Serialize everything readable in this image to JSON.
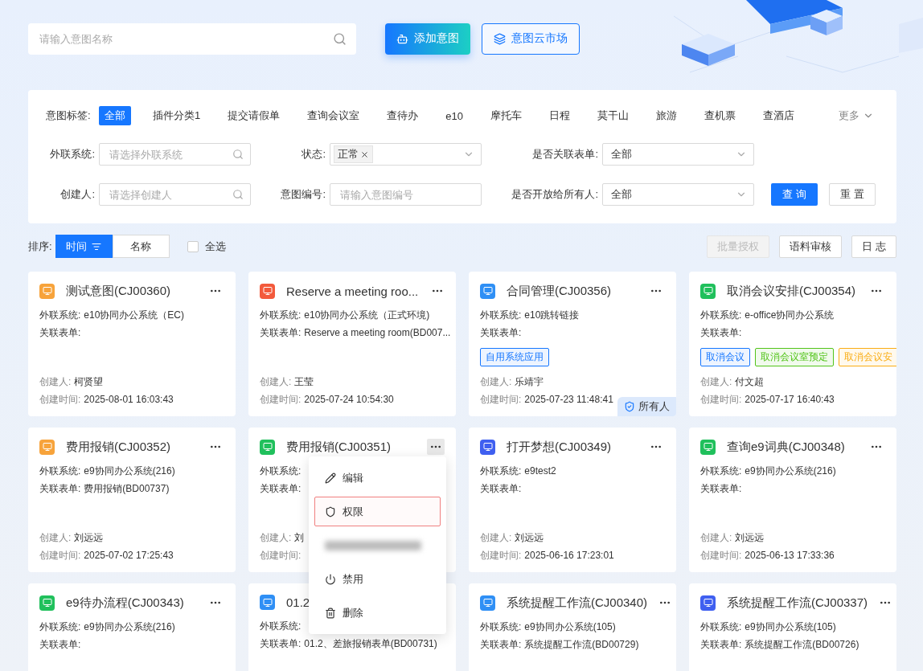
{
  "search": {
    "placeholder": "请输入意图名称"
  },
  "actions": [
    {
      "label": "添加意图",
      "kind": "primary"
    },
    {
      "label": "意图云市场",
      "kind": "outline"
    }
  ],
  "filters": {
    "tag_label": "意图标签:",
    "tags": [
      {
        "label": "全部",
        "selected": true
      },
      {
        "label": "插件分类1",
        "selected": false
      },
      {
        "label": "提交请假单",
        "selected": false
      },
      {
        "label": "查询会议室",
        "selected": false
      },
      {
        "label": "查待办",
        "selected": false
      },
      {
        "label": "e10",
        "selected": false
      },
      {
        "label": "摩托车",
        "selected": false
      },
      {
        "label": "日程",
        "selected": false
      },
      {
        "label": "莫干山",
        "selected": false
      },
      {
        "label": "旅游",
        "selected": false
      },
      {
        "label": "查机票",
        "selected": false
      },
      {
        "label": "查酒店",
        "selected": false
      }
    ],
    "more": "更多",
    "fields": [
      {
        "label": "外联系统:",
        "kind": "search",
        "placeholder": "请选择外联系统"
      },
      {
        "label": "状态:",
        "kind": "chips",
        "chips": [
          "正常"
        ]
      },
      {
        "label": "是否关联表单:",
        "kind": "select",
        "value": "全部"
      },
      {
        "label": "创建人:",
        "kind": "search",
        "placeholder": "请选择创建人"
      },
      {
        "label": "意图编号:",
        "kind": "text",
        "placeholder": "请输入意图编号"
      },
      {
        "label": "是否开放给所有人:",
        "kind": "select",
        "value": "全部"
      }
    ],
    "buttons": [
      {
        "label": "查 询",
        "kind": "primary"
      },
      {
        "label": "重 置",
        "kind": "outline"
      }
    ]
  },
  "toolbar": {
    "sort_label": "排序:",
    "sort_options": [
      {
        "label": "时间",
        "selected": true
      },
      {
        "label": "名称",
        "selected": false
      }
    ],
    "select_all": {
      "label": "全选",
      "checked": false
    },
    "buttons": [
      {
        "label": "批量授权",
        "disabled": true
      },
      {
        "label": "语料审核",
        "disabled": false
      },
      {
        "label": "日 志",
        "disabled": false
      }
    ]
  },
  "cards": [
    {
      "title": "测试意图(CJ00360)",
      "color": "#f7a33b",
      "system_label": "外联系统:",
      "system": "e10协同办公系统（EC)",
      "form_label": "关联表单:",
      "creator_label": "创建人:",
      "creator": "柯贤望",
      "time_label": "创建时间:",
      "time": "2025-08-01 16:03:43",
      "menu_open": false
    },
    {
      "title": "Reserve a meeting roo...",
      "color": "#f35a3c",
      "system_label": "外联系统:",
      "system": "e10协同办公系统（正式环境)",
      "form_label": "关联表单:",
      "form": "Reserve a meeting room(BD007...",
      "creator_label": "创建人:",
      "creator": "王莹",
      "time_label": "创建时间:",
      "time": "2025-07-24 10:54:30",
      "menu_open": false
    },
    {
      "title": "合同管理(CJ00356)",
      "color": "#2f8ff5",
      "system_label": "外联系统:",
      "system": "e10跳转链接",
      "form_label": "关联表单:",
      "tags": [
        {
          "label": "自用系统应用",
          "color": "#1677ff"
        }
      ],
      "creator_label": "创建人:",
      "creator": "乐靖宇",
      "time_label": "创建时间:",
      "time": "2025-07-23 11:48:41",
      "badge": "所有人",
      "menu_open": false
    },
    {
      "title": "取消会议安排(CJ00354)",
      "color": "#20c05c",
      "system_label": "外联系统:",
      "system": "e-office协同办公系统",
      "form_label": "关联表单:",
      "tags": [
        {
          "label": "取消会议",
          "color": "#1677ff"
        },
        {
          "label": "取消会议室预定",
          "color": "#52c41a"
        },
        {
          "label": "取消会议安",
          "color": "#faad14"
        }
      ],
      "creator_label": "创建人:",
      "creator": "付文超",
      "time_label": "创建时间:",
      "time": "2025-07-17 16:40:43",
      "menu_open": false
    },
    {
      "title": "费用报销(CJ00352)",
      "color": "#f7a33b",
      "system_label": "外联系统:",
      "system": "e9协同办公系统(216)",
      "form_label": "关联表单:",
      "form": "费用报销(BD00737)",
      "creator_label": "创建人:",
      "creator": "刘远远",
      "time_label": "创建时间:",
      "time": "2025-07-02 17:25:43",
      "menu_open": false
    },
    {
      "title": "费用报销(CJ00351)",
      "color": "#20c05c",
      "system_label": "外联系统:",
      "form_label": "关联表单:",
      "creator_label": "创建人:",
      "creator": "刘",
      "time_label": "创建时间:",
      "menu_open": true
    },
    {
      "title": "打开梦想(CJ00349)",
      "color": "#3f5ff0",
      "system_label": "外联系统:",
      "system": "e9test2",
      "form_label": "关联表单:",
      "creator_label": "创建人:",
      "creator": "刘远远",
      "time_label": "创建时间:",
      "time": "2025-06-16 17:23:01",
      "menu_open": false
    },
    {
      "title": "查询e9词典(CJ00348)",
      "color": "#20c05c",
      "system_label": "外联系统:",
      "system": "e9协同办公系统(216)",
      "form_label": "关联表单:",
      "creator_label": "创建人:",
      "creator": "刘远远",
      "time_label": "创建时间:",
      "time": "2025-06-13 17:33:36",
      "menu_open": false
    },
    {
      "title": "e9待办流程(CJ00343)",
      "color": "#20c05c",
      "system_label": "外联系统:",
      "system": "e9协同办公系统(216)",
      "form_label": "关联表单:",
      "menu_open": false
    },
    {
      "title": "01.2",
      "color": "#2f8ff5",
      "system_label": "外联系统:",
      "form_label": "关联表单:",
      "form": "01.2、差旅报销表单(BD00731)"
    },
    {
      "title": "系统提醒工作流(CJ00340)",
      "color": "#2f8ff5",
      "system_label": "外联系统:",
      "system": "e9协同办公系统(105)",
      "form_label": "关联表单:",
      "form": "系统提醒工作流(BD00729)",
      "menu_open": false
    },
    {
      "title": "系统提醒工作流(CJ00337)",
      "color": "#3f5ff0",
      "system_label": "外联系统:",
      "system": "e9协同办公系统(105)",
      "form_label": "关联表单:",
      "form": "系统提醒工作流(BD00726)",
      "menu_open": false
    }
  ],
  "menu": {
    "items": [
      {
        "label": "编辑",
        "kind": "edit",
        "highlighted": false
      },
      {
        "label": "权限",
        "kind": "permission",
        "highlighted": true
      },
      {
        "kind": "blurred",
        "highlighted": false
      },
      {
        "label": "禁用",
        "kind": "disable",
        "highlighted": false
      },
      {
        "label": "删除",
        "kind": "delete",
        "highlighted": false
      }
    ]
  }
}
